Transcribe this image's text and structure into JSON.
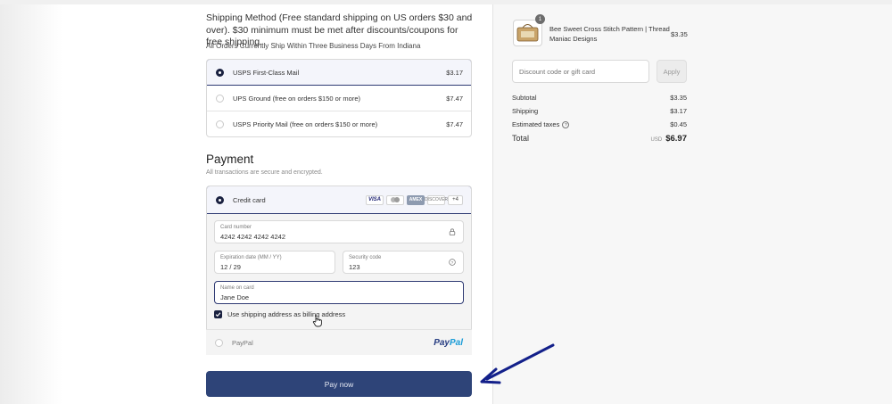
{
  "shipping": {
    "title": "Shipping Method (Free standard shipping on US orders $30 and over). $30 minimum must be met after discounts/coupons for free shipping.",
    "note": "All Orders Currently Ship Within Three Business Days From Indiana",
    "options": [
      {
        "label": "USPS First-Class Mail",
        "price": "$3.17",
        "selected": true
      },
      {
        "label": "UPS Ground (free on orders $150 or more)",
        "price": "$7.47",
        "selected": false
      },
      {
        "label": "USPS Priority Mail (free on orders $150 or more)",
        "price": "$7.47",
        "selected": false
      }
    ]
  },
  "payment": {
    "title": "Payment",
    "subtitle": "All transactions are secure and encrypted.",
    "credit_card_label": "Credit card",
    "card_logos": {
      "visa": "VISA",
      "amex": "AMEX",
      "discover": "DISCOVER",
      "more": "+4"
    },
    "card_number": {
      "label": "Card number",
      "value": "4242 4242 4242 4242"
    },
    "expiration": {
      "label": "Expiration date (MM / YY)",
      "value": "12 / 29"
    },
    "security_code": {
      "label": "Security code",
      "value": "123"
    },
    "name_on_card": {
      "label": "Name on card",
      "value": "Jane Doe"
    },
    "billing_checkbox_label": "Use shipping address as billing address",
    "billing_checked": true,
    "paypal_label": "PayPal",
    "paypal_logo_pay": "Pay",
    "paypal_logo_pal": "Pal",
    "pay_button": "Pay now"
  },
  "summary": {
    "product": {
      "quantity": "1",
      "name": "Bee Sweet Cross Stitch Pattern | Thread Maniac Designs",
      "price": "$3.35"
    },
    "discount_placeholder": "Discount code or gift card",
    "apply_label": "Apply",
    "rows": [
      {
        "label": "Subtotal",
        "value": "$3.35"
      },
      {
        "label": "Shipping",
        "value": "$3.17"
      },
      {
        "label": "Estimated taxes",
        "value": "$0.45"
      }
    ],
    "total_label": "Total",
    "currency": "USD",
    "total_value": "$6.97"
  },
  "colors": {
    "accent": "#2e4478",
    "selected_border": "#2e3a73",
    "annotation_arrow": "#13208a"
  }
}
